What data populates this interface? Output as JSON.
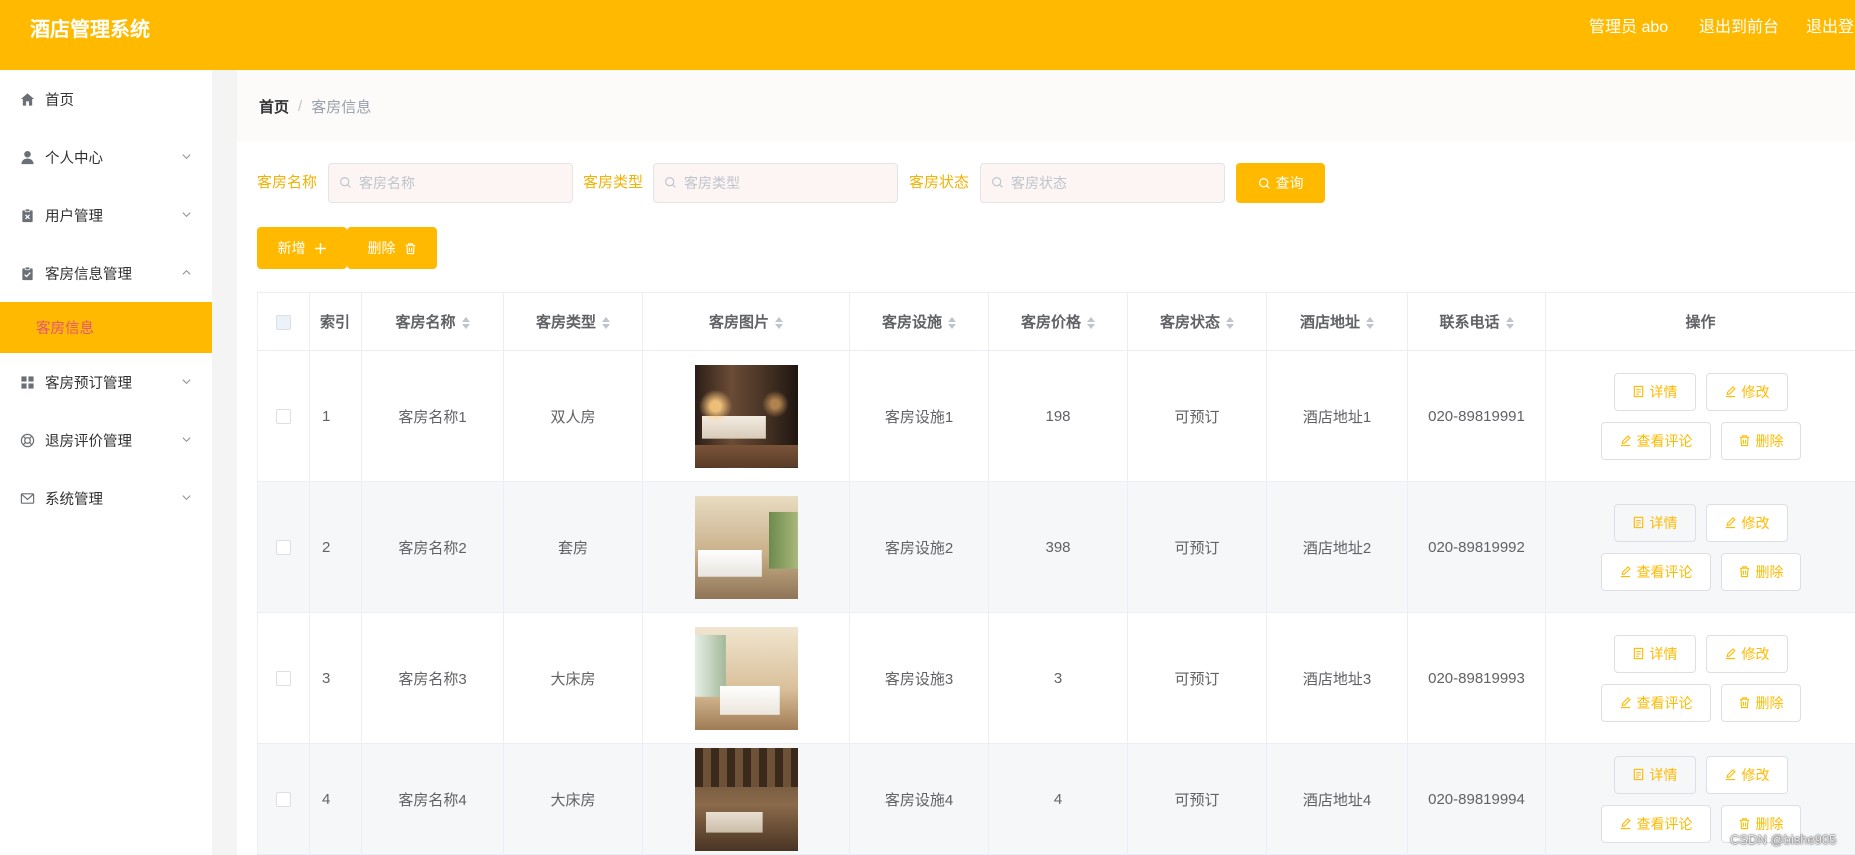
{
  "colors": {
    "primary": "#FFBA00",
    "active_sub_text": "#E4537A",
    "label_text": "#F2B204"
  },
  "header": {
    "title": "酒店管理系统",
    "user_label": "管理员 abo",
    "front_link": "退出到前台",
    "logout_link": "退出登"
  },
  "sidebar": {
    "items": [
      {
        "label": "首页",
        "icon": "home-icon"
      },
      {
        "label": "个人中心",
        "icon": "user-icon",
        "expanded": false
      },
      {
        "label": "用户管理",
        "icon": "clipboard-x-icon",
        "expanded": false
      },
      {
        "label": "客房信息管理",
        "icon": "clipboard-check-icon",
        "expanded": true,
        "children": [
          {
            "label": "客房信息",
            "active": true
          }
        ]
      },
      {
        "label": "客房预订管理",
        "icon": "grid-icon",
        "expanded": false
      },
      {
        "label": "退房评价管理",
        "icon": "life-ring-icon",
        "expanded": false
      },
      {
        "label": "系统管理",
        "icon": "envelope-icon",
        "expanded": false
      }
    ]
  },
  "breadcrumb": {
    "home": "首页",
    "separator": "/",
    "current": "客房信息"
  },
  "search": {
    "fields": [
      {
        "label": "客房名称",
        "placeholder": "客房名称",
        "value": ""
      },
      {
        "label": "客房类型",
        "placeholder": "客房类型",
        "value": ""
      },
      {
        "label": "客房状态",
        "placeholder": "客房状态",
        "value": ""
      }
    ],
    "submit_label": "查询",
    "submit_icon": "search-icon"
  },
  "actions": {
    "add_label": "新增",
    "add_icon": "plus-icon",
    "delete_label": "删除",
    "delete_icon": "trash-icon"
  },
  "table": {
    "columns": [
      {
        "label": "索引",
        "sortable": false
      },
      {
        "label": "客房名称",
        "sortable": true
      },
      {
        "label": "客房类型",
        "sortable": true
      },
      {
        "label": "客房图片",
        "sortable": true
      },
      {
        "label": "客房设施",
        "sortable": true
      },
      {
        "label": "客房价格",
        "sortable": true
      },
      {
        "label": "客房状态",
        "sortable": true
      },
      {
        "label": "酒店地址",
        "sortable": true
      },
      {
        "label": "联系电话",
        "sortable": true
      },
      {
        "label": "操作",
        "sortable": false
      }
    ],
    "rows": [
      {
        "index": 1,
        "name": "客房名称1",
        "type": "双人房",
        "facility": "客房设施1",
        "price": 198,
        "status": "可预订",
        "address": "酒店地址1",
        "phone": "020-89819991"
      },
      {
        "index": 2,
        "name": "客房名称2",
        "type": "套房",
        "facility": "客房设施2",
        "price": 398,
        "status": "可预订",
        "address": "酒店地址2",
        "phone": "020-89819992"
      },
      {
        "index": 3,
        "name": "客房名称3",
        "type": "大床房",
        "facility": "客房设施3",
        "price": 3,
        "status": "可预订",
        "address": "酒店地址3",
        "phone": "020-89819993"
      },
      {
        "index": 4,
        "name": "客房名称4",
        "type": "大床房",
        "facility": "客房设施4",
        "price": 4,
        "status": "可预订",
        "address": "酒店地址4",
        "phone": "020-89819994"
      }
    ],
    "row_actions": {
      "detail": "详情",
      "edit": "修改",
      "reviews": "查看评论",
      "delete": "删除"
    }
  },
  "watermark": "CSDN @bishe905"
}
